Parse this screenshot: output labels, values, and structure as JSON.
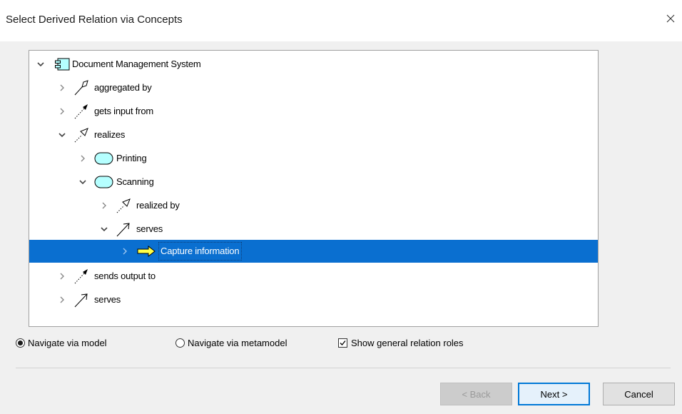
{
  "window": {
    "title": "Select Derived Relation via Concepts"
  },
  "tree": {
    "rows": [
      {
        "label": "Document Management System",
        "expanded": true,
        "icon": "application-component-icon"
      },
      {
        "label": "aggregated by",
        "expanded": false,
        "icon": "aggregation-relation-icon"
      },
      {
        "label": "gets input from",
        "expanded": false,
        "icon": "access-relation-icon"
      },
      {
        "label": "realizes",
        "expanded": true,
        "icon": "realization-relation-icon"
      },
      {
        "label": "Printing",
        "expanded": false,
        "icon": "application-service-icon"
      },
      {
        "label": "Scanning",
        "expanded": true,
        "icon": "application-service-icon"
      },
      {
        "label": "realized by",
        "expanded": false,
        "icon": "realization-relation-icon"
      },
      {
        "label": "serves",
        "expanded": true,
        "icon": "serving-relation-icon"
      },
      {
        "label": "Capture information",
        "expanded": false,
        "selected": true,
        "icon": "business-process-icon"
      },
      {
        "label": "sends output to",
        "expanded": false,
        "icon": "access-relation-icon"
      },
      {
        "label": "serves",
        "expanded": false,
        "icon": "serving-relation-icon"
      }
    ]
  },
  "options": {
    "navigate_model": "Navigate via model",
    "navigate_metamodel": "Navigate via metamodel",
    "show_general": "Show general relation roles",
    "selected_navigation": "model",
    "show_general_checked": true
  },
  "buttons": {
    "back": "< Back",
    "next": "Next >",
    "cancel": "Cancel"
  },
  "colors": {
    "selection": "#0a6fd0",
    "service_fill": "#b5ffff",
    "process_arrow": "#ffff46",
    "default_button_border": "#0078d7"
  }
}
